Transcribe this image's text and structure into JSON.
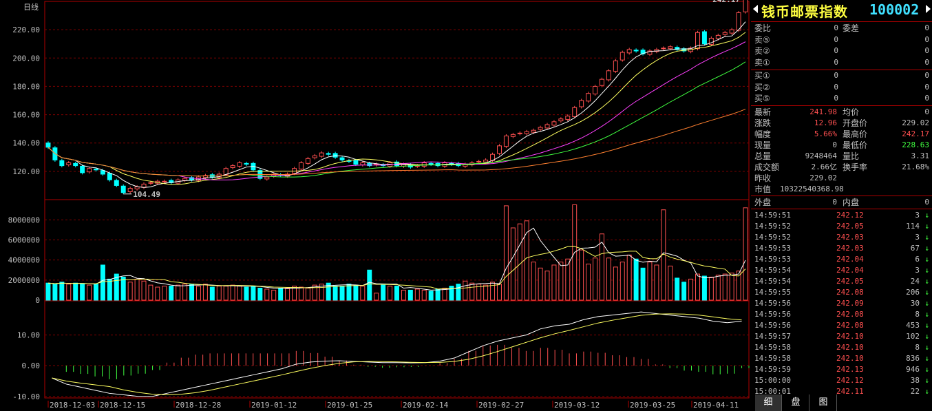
{
  "chart": {
    "period_label": "日线",
    "price_axis": {
      "ticks": [
        "220.00",
        "200.00",
        "180.00",
        "160.00",
        "140.00",
        "120.00"
      ],
      "min": 100,
      "max": 240
    },
    "volume_axis": {
      "ticks": [
        "8000000",
        "6000000",
        "4000000",
        "2000000",
        "0"
      ],
      "max": 9600000
    },
    "macd_axis": {
      "ticks": [
        "10.00",
        "0.00",
        "-10.00"
      ],
      "min": -10.5,
      "max": 20
    },
    "dates": [
      "2018-12-03",
      "2018-12-15",
      "2018-12-28",
      "2019-01-12",
      "2019-01-25",
      "2019-02-14",
      "2019-02-27",
      "2019-03-12",
      "2019-03-25",
      "2019-04-11"
    ],
    "low_marker": "104.49",
    "high_marker": "242.17",
    "colors": {
      "up": "#ff5050",
      "down": "#00ffff",
      "ma5": "#ffffff",
      "ma10": "#ffff60",
      "ma20": "#ff40ff",
      "ma30": "#40ff40",
      "ma60": "#ff8030",
      "grid": "#800000"
    }
  },
  "chart_data": {
    "type": "candlestick",
    "close": [
      137,
      128,
      124,
      126,
      124,
      119,
      122,
      121,
      118,
      114,
      110,
      105,
      108,
      109,
      111,
      112,
      113,
      113,
      112,
      114,
      115,
      114,
      116,
      117,
      116,
      118,
      122,
      124,
      126,
      125,
      121,
      115,
      116,
      118,
      117,
      118,
      122,
      126,
      129,
      131,
      133,
      132,
      130,
      128,
      127,
      125,
      126,
      124,
      125,
      124,
      126,
      124,
      125,
      123,
      124,
      126,
      125,
      124,
      126,
      125,
      124,
      125,
      126,
      127,
      128,
      132,
      138,
      145,
      146,
      147,
      148,
      149,
      151,
      153,
      155,
      157,
      159,
      165,
      170,
      175,
      180,
      185,
      191,
      198,
      204,
      206,
      205,
      203,
      205,
      206,
      207,
      208,
      206,
      205,
      207,
      218,
      210,
      214,
      216,
      218,
      220,
      232,
      242
    ],
    "volume": [
      1.7,
      1.6,
      1.8,
      1.6,
      1.7,
      1.6,
      1.5,
      1.6,
      3.5,
      2.1,
      2.6,
      2.3,
      1.8,
      2.1,
      1.9,
      1.5,
      1.3,
      1.4,
      1.4,
      1.5,
      1.6,
      1.6,
      1.4,
      1.6,
      1.3,
      1.4,
      1.4,
      1.5,
      1.4,
      1.3,
      1.4,
      1.2,
      1.1,
      1.0,
      1.2,
      1.2,
      1.4,
      1.3,
      1.2,
      1.5,
      1.6,
      1.7,
      1.4,
      1.4,
      1.6,
      1.5,
      1.4,
      3.0,
      0.7,
      1.5,
      1.4,
      1.4,
      1.0,
      1.0,
      1.1,
      1.0,
      0.9,
      1.1,
      1.2,
      1.4,
      1.6,
      1.9,
      1.7,
      1.6,
      1.5,
      1.8,
      1.6,
      9.4,
      7.2,
      7.6,
      7.9,
      3.8,
      3.2,
      2.9,
      3.5,
      3.8,
      4.1,
      9.5,
      5.0,
      3.6,
      4.2,
      6.6,
      4.2,
      3.3,
      3.8,
      4.5,
      4.1,
      3.2,
      3.8,
      3.5,
      9.0,
      3.4,
      2.2,
      1.8,
      2.1,
      2.6,
      2.4,
      2.3,
      2.5,
      2.6,
      2.7,
      2.9,
      9.2
    ],
    "macd_lines": {
      "dif": [
        -4,
        -6,
        -7,
        -8,
        -9,
        -9.5,
        -10,
        -10,
        -9,
        -8,
        -7,
        -6,
        -5,
        -4,
        -3,
        -2,
        -1,
        0.5,
        1.2,
        1.5,
        1.6,
        1.4,
        1.2,
        1.0,
        1.0,
        0.9,
        1.0,
        1.5,
        2.5,
        4.5,
        6.5,
        8,
        9,
        10,
        12,
        13,
        13.5,
        15,
        16,
        16.5,
        17,
        17.5,
        17,
        16.5,
        16,
        15.5,
        14.5,
        14,
        14.5
      ]
    }
  },
  "panel": {
    "title_name": "钱币邮票指数",
    "title_code": "100002",
    "order_book": [
      {
        "label": "委比",
        "value": "0",
        "label2": "委差",
        "value2": "0"
      },
      {
        "label": "卖⑤",
        "value": "0",
        "value2": "0"
      },
      {
        "label": "卖②",
        "value": "0",
        "value2": "0"
      },
      {
        "label": "卖①",
        "value": "0",
        "value2": "0"
      },
      {
        "label": "买①",
        "value": "0",
        "value2": "0"
      },
      {
        "label": "买②",
        "value": "0",
        "value2": "0"
      },
      {
        "label": "买⑤",
        "value": "0",
        "value2": "0"
      }
    ],
    "quote": [
      {
        "label": "最新",
        "value": "241.98",
        "vcolor": "#ff5050",
        "label2": "均价",
        "value2": "0",
        "v2color": "#c0c0c0"
      },
      {
        "label": "涨跌",
        "value": "12.96",
        "vcolor": "#ff5050",
        "label2": "开盘价",
        "value2": "229.02",
        "v2color": "#c0c0c0"
      },
      {
        "label": "幅度",
        "value": "5.66%",
        "vcolor": "#ff5050",
        "label2": "最高价",
        "value2": "242.17",
        "v2color": "#ff5050"
      },
      {
        "label": "现量",
        "value": "0",
        "vcolor": "#c0c0c0",
        "label2": "最低价",
        "value2": "228.63",
        "v2color": "#40ff40"
      },
      {
        "label": "总量",
        "value": "9248464",
        "vcolor": "#c0c0c0",
        "label2": "量比",
        "value2": "3.31",
        "v2color": "#c0c0c0"
      },
      {
        "label": "成交额",
        "value": "2.66亿",
        "vcolor": "#c0c0c0",
        "label2": "换手率",
        "value2": "21.68%",
        "v2color": "#c0c0c0"
      },
      {
        "label": "昨收",
        "value": "229.02",
        "vcolor": "#c0c0c0",
        "label2": "",
        "value2": "",
        "v2color": "#c0c0c0"
      },
      {
        "label": "市值",
        "value": "10322540368.98",
        "vcolor": "#c0c0c0",
        "label2": "",
        "value2": "",
        "v2color": "#c0c0c0"
      }
    ],
    "outer": {
      "label": "外盘",
      "value": "0",
      "label2": "内盘",
      "value2": "0"
    },
    "ticks": [
      {
        "time": "14:59:51",
        "price": "242.12",
        "vol": "3",
        "arrow": "↓"
      },
      {
        "time": "14:59:52",
        "price": "242.05",
        "vol": "114",
        "arrow": "↓"
      },
      {
        "time": "14:59:52",
        "price": "242.03",
        "vol": "3",
        "arrow": "↓"
      },
      {
        "time": "14:59:53",
        "price": "242.03",
        "vol": "67",
        "arrow": "↓"
      },
      {
        "time": "14:59:53",
        "price": "242.04",
        "vol": "6",
        "arrow": "↓"
      },
      {
        "time": "14:59:54",
        "price": "242.04",
        "vol": "3",
        "arrow": "↓"
      },
      {
        "time": "14:59:54",
        "price": "242.05",
        "vol": "24",
        "arrow": "↓"
      },
      {
        "time": "14:59:55",
        "price": "242.08",
        "vol": "206",
        "arrow": "↓"
      },
      {
        "time": "14:59:56",
        "price": "242.09",
        "vol": "30",
        "arrow": "↓"
      },
      {
        "time": "14:59:56",
        "price": "242.08",
        "vol": "8",
        "arrow": "↓"
      },
      {
        "time": "14:59:56",
        "price": "242.08",
        "vol": "453",
        "arrow": "↓"
      },
      {
        "time": "14:59:57",
        "price": "242.10",
        "vol": "102",
        "arrow": "↓"
      },
      {
        "time": "14:59:58",
        "price": "242.10",
        "vol": "8",
        "arrow": "↓"
      },
      {
        "time": "14:59:58",
        "price": "242.10",
        "vol": "836",
        "arrow": "↓"
      },
      {
        "time": "14:59:59",
        "price": "242.13",
        "vol": "946",
        "arrow": "↓"
      },
      {
        "time": "15:00:00",
        "price": "242.12",
        "vol": "38",
        "arrow": "↓"
      },
      {
        "time": "15:00:01",
        "price": "242.11",
        "vol": "22",
        "arrow": "↓"
      }
    ],
    "tabs": [
      "细",
      "盘",
      "图"
    ]
  }
}
